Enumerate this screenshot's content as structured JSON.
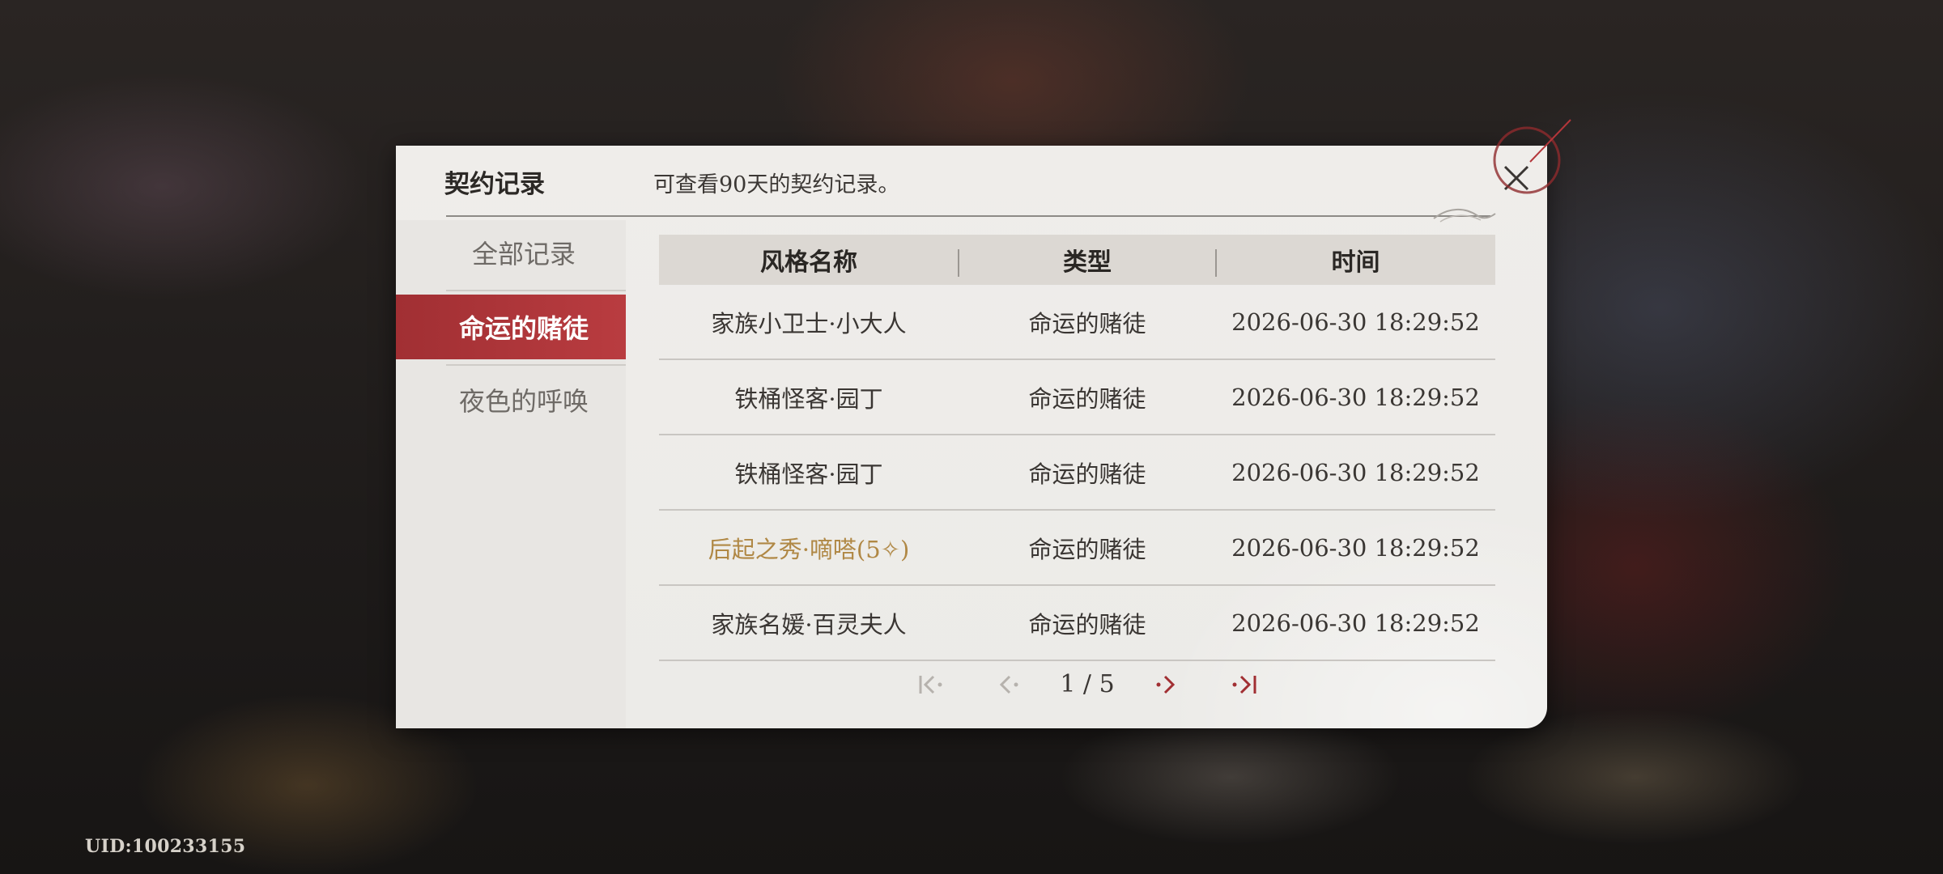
{
  "uid": "UID:100233155",
  "dialog": {
    "title": "契约记录",
    "subtitle": "可查看90天的契约记录。"
  },
  "nav": {
    "items": [
      {
        "label": "全部记录",
        "active": false
      },
      {
        "label": "命运的赌徒",
        "active": true
      },
      {
        "label": "夜色的呼唤",
        "active": false
      }
    ]
  },
  "table": {
    "headers": [
      "风格名称",
      "类型",
      "时间"
    ],
    "rows": [
      {
        "name": "家族小卫士·小大人",
        "type": "命运的赌徒",
        "time": "2026-06-30 18:29:52",
        "rare": false
      },
      {
        "name": "铁桶怪客·园丁",
        "type": "命运的赌徒",
        "time": "2026-06-30 18:29:52",
        "rare": false
      },
      {
        "name": "铁桶怪客·园丁",
        "type": "命运的赌徒",
        "time": "2026-06-30 18:29:52",
        "rare": false
      },
      {
        "name": "后起之秀·嘀嗒(5✧)",
        "type": "命运的赌徒",
        "time": "2026-06-30 18:29:52",
        "rare": true
      },
      {
        "name": "家族名媛·百灵夫人",
        "type": "命运的赌徒",
        "time": "2026-06-30 18:29:52",
        "rare": false
      }
    ]
  },
  "pager": {
    "text": "1 / 5",
    "first_icon": "first-page-icon",
    "prev_icon": "prev-page-icon",
    "next_icon": "next-page-icon",
    "last_icon": "last-page-icon"
  },
  "colors": {
    "accent_red": "#a12f33",
    "rare_gold": "#b08845",
    "pager_disabled": "#b6b2ad"
  }
}
